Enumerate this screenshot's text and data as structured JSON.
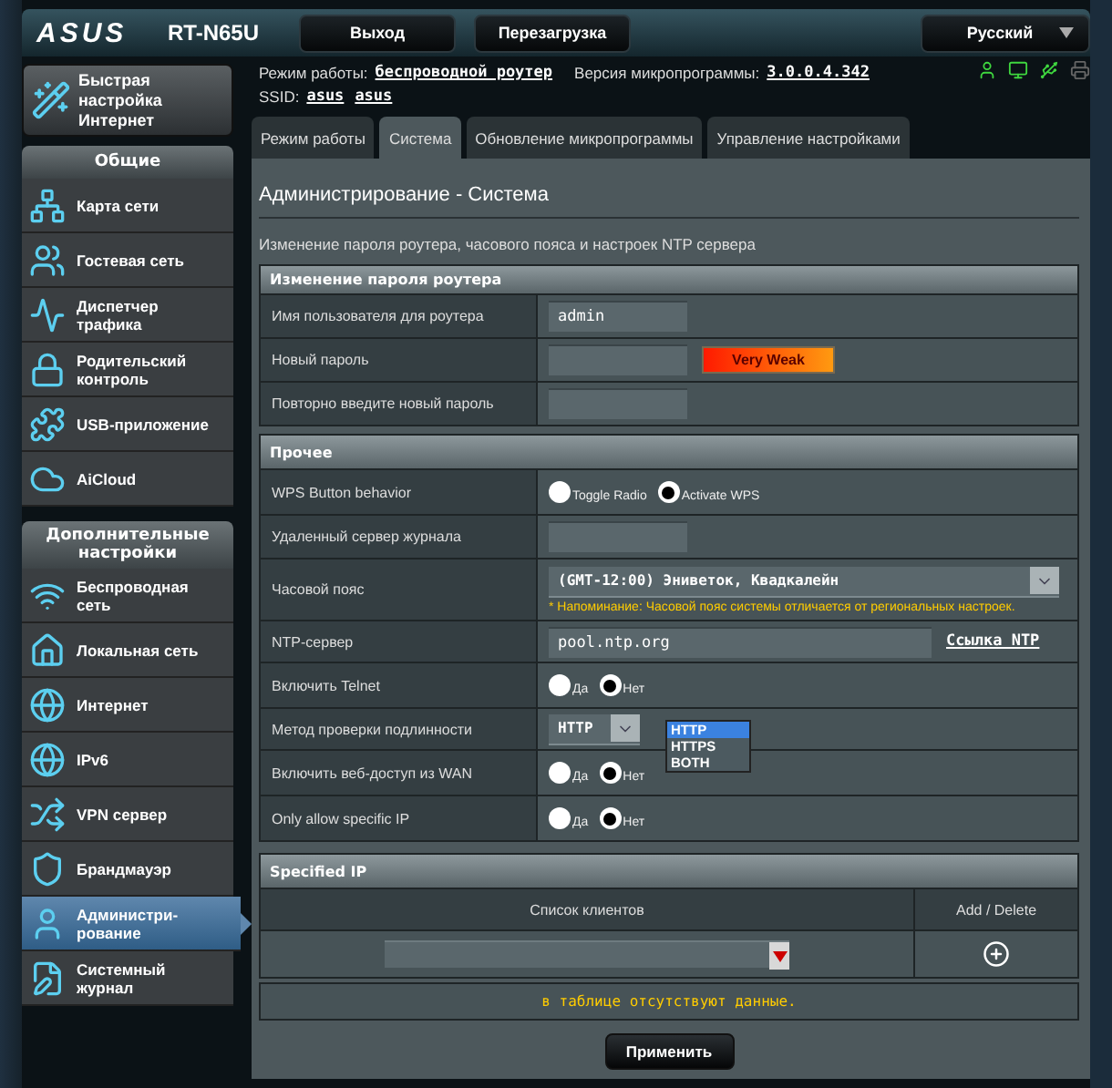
{
  "header": {
    "brand": "ASUS",
    "model": "RT-N65U",
    "buttons": [
      "Выход",
      "Перезагрузка"
    ],
    "language": "Русский"
  },
  "info": {
    "mode_label": "Режим работы:",
    "mode": "беспроводной роутер",
    "firmware_label": "Версия микропрограммы:",
    "firmware": "3.0.0.4.342",
    "ssid_label": "SSID:",
    "ssids": [
      "asus",
      "asus"
    ]
  },
  "sidebar": {
    "quick_setup": "Быстрая настройка Интернет",
    "sections": [
      {
        "title": "Общие",
        "items": [
          {
            "label": "Карта сети",
            "selected": false
          },
          {
            "label": "Гостевая сеть",
            "selected": false
          },
          {
            "label": "Диспетчер трафика",
            "selected": false
          },
          {
            "label": "Родительский контроль",
            "selected": false
          },
          {
            "label": "USB-приложение",
            "selected": false
          },
          {
            "label": "AiCloud",
            "selected": false
          }
        ]
      },
      {
        "title": "Дополнительные настройки",
        "items": [
          {
            "label": "Беспроводная сеть",
            "selected": false
          },
          {
            "label": "Локальная сеть",
            "selected": false
          },
          {
            "label": "Интернет",
            "selected": false
          },
          {
            "label": "IPv6",
            "selected": false
          },
          {
            "label": "VPN сервер",
            "selected": false
          },
          {
            "label": "Брандмауэр",
            "selected": false
          },
          {
            "label": "Администри-рование",
            "selected": true
          },
          {
            "label": "Системный журнал",
            "selected": false
          }
        ]
      }
    ]
  },
  "tabs": [
    {
      "label": "Режим работы",
      "selected": false
    },
    {
      "label": "Система",
      "selected": true
    },
    {
      "label": "Обновление микропрограммы",
      "selected": false
    },
    {
      "label": "Управление настройками",
      "selected": false
    }
  ],
  "page": {
    "title": "Администрирование - Система",
    "description": "Изменение пароля роутера, часового пояса и настроек NTP сервера",
    "sections": [
      {
        "title": "Изменение пароля роутера",
        "rows": [
          {
            "kind": "text",
            "label": "Имя пользователя для роутера",
            "value": "admin"
          },
          {
            "kind": "password",
            "label": "Новый пароль",
            "strength": "Very Weak"
          },
          {
            "kind": "password",
            "label": "Повторно введите новый пароль"
          }
        ]
      },
      {
        "title": "Прочее",
        "rows": [
          {
            "kind": "radio",
            "label": "WPS Button behavior",
            "options": [
              {
                "label": "Toggle Radio",
                "selected": false
              },
              {
                "label": "Activate WPS",
                "selected": true
              }
            ]
          },
          {
            "kind": "text",
            "label": "Удаленный сервер журнала"
          },
          {
            "kind": "select",
            "label": "Часовой пояс",
            "value": "(GMT-12:00) Эниветок, Квадкалейн",
            "note": "* Напоминание: Часовой пояс системы отличается от региональных настроек."
          },
          {
            "kind": "text",
            "label": "NTP-сервер",
            "value": "pool.ntp.org",
            "link": "Ссылка NTP"
          },
          {
            "kind": "radio",
            "label": "Включить Telnet",
            "options": [
              {
                "label": "Да",
                "selected": false
              },
              {
                "label": "Нет",
                "selected": true
              }
            ]
          },
          {
            "kind": "select",
            "label": "Метод проверки подлинности",
            "value": "HTTP",
            "expanded": true,
            "options": [
              {
                "label": "HTTP",
                "selected": true
              },
              {
                "label": "HTTPS",
                "selected": false
              },
              {
                "label": "BOTH",
                "selected": false
              }
            ]
          },
          {
            "kind": "radio",
            "label": "Включить веб-доступ из WAN",
            "options": [
              {
                "label": "Да",
                "selected": false
              },
              {
                "label": "Нет",
                "selected": true
              }
            ]
          },
          {
            "kind": "radio",
            "label": "Only allow specific IP",
            "options": [
              {
                "label": "Да",
                "selected": false
              },
              {
                "label": "Нет",
                "selected": true
              }
            ]
          }
        ]
      }
    ]
  },
  "specified_ip": {
    "title": "Specified IP",
    "columns": [
      "Список клиентов",
      "Add / Delete"
    ],
    "empty_message": "в таблице отсутствуют данные."
  },
  "apply_button": "Применить"
}
